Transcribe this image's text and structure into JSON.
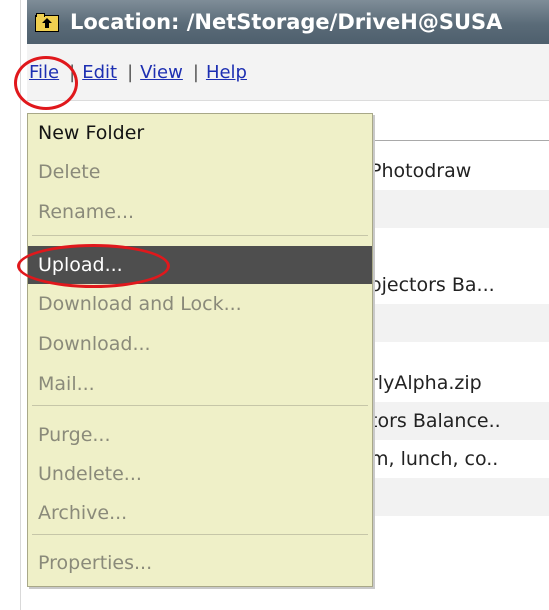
{
  "window": {
    "location_text": "Location: /NetStorage/DriveH@SUSA",
    "folder_icon": "folder-up-icon"
  },
  "menubar": {
    "file": "File",
    "edit": "Edit",
    "view": "View",
    "help": "Help",
    "separator": "|"
  },
  "file_menu": {
    "items": [
      {
        "label": "New Folder",
        "enabled": true
      },
      {
        "label": "Delete",
        "enabled": false
      },
      {
        "label": "Rename...",
        "enabled": false
      },
      {
        "label": "Upload...",
        "enabled": true,
        "selected": true
      },
      {
        "label": "Download and Lock...",
        "enabled": false
      },
      {
        "label": "Download...",
        "enabled": false
      },
      {
        "label": "Mail...",
        "enabled": false
      },
      {
        "label": "Purge...",
        "enabled": false
      },
      {
        "label": "Undelete...",
        "enabled": false
      },
      {
        "label": "Archive...",
        "enabled": false
      },
      {
        "label": "Properties...",
        "enabled": false
      }
    ]
  },
  "file_list": {
    "rows": [
      {
        "text": "Photodraw"
      },
      {
        "text": ""
      },
      {
        "text": ""
      },
      {
        "text": "ojectors Ba..."
      },
      {
        "text": ""
      },
      {
        "text": "rlyAlpha.zip"
      },
      {
        "text": "tors Balance.."
      },
      {
        "text": "m, lunch, co.."
      },
      {
        "text": ""
      }
    ]
  },
  "annotation_color": "#e0181c"
}
